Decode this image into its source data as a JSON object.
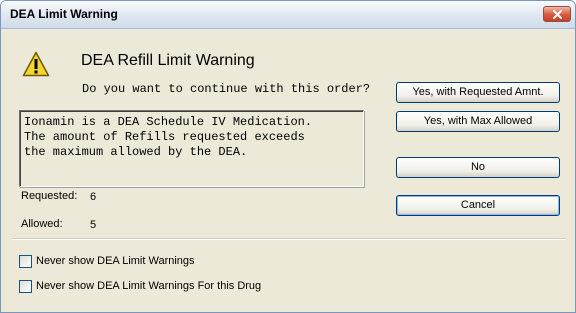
{
  "window": {
    "title": "DEA Limit Warning",
    "close_icon": "close-icon"
  },
  "dialog": {
    "icon": "warning-icon",
    "heading": "DEA Refill Limit Warning",
    "question": "Do you want to continue with this order?",
    "message_lines": [
      "Ionamin is a DEA Schedule IV Medication.",
      "The amount of Refills requested exceeds",
      "the maximum allowed by the DEA."
    ],
    "requested_label": "Requested:",
    "requested_value": "6",
    "allowed_label": "Allowed:",
    "allowed_value": "5"
  },
  "buttons": {
    "yes_requested": "Yes, with Requested Amnt.",
    "yes_max": "Yes, with Max Allowed",
    "no": "No",
    "cancel": "Cancel"
  },
  "checkboxes": [
    {
      "label": "Never show DEA Limit Warnings",
      "checked": false
    },
    {
      "label": "Never show DEA Limit Warnings For this Drug",
      "checked": false
    }
  ],
  "colors": {
    "dialog_bg": "#ece9d8",
    "button_border": "#003c74",
    "warning_yellow": "#f7d531"
  }
}
